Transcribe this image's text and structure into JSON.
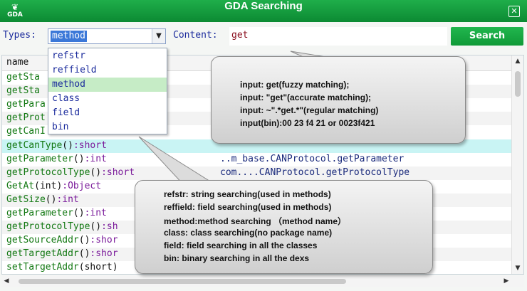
{
  "window": {
    "title": "GDA Searching",
    "logo_text": "GDA",
    "close_glyph": "✕"
  },
  "toolbar": {
    "types_label": "Types:",
    "types_selected": "method",
    "content_label": "Content:",
    "content_value": "get",
    "search_label": "Search"
  },
  "table": {
    "header_name": "name",
    "rows": [
      {
        "method": "getSta",
        "params": "",
        "ret": "",
        "path": ""
      },
      {
        "method": "getSta",
        "params": "",
        "ret": "",
        "path": ""
      },
      {
        "method": "getPara",
        "params": "",
        "ret": "",
        "path": ""
      },
      {
        "method": "getProt",
        "params": "",
        "ret": "",
        "path": ""
      },
      {
        "method": "getCanI",
        "params": "",
        "ret": "",
        "path": ""
      },
      {
        "method": "getCanType",
        "params": "()",
        "ret": ":short",
        "path": ""
      },
      {
        "method": "getParameter",
        "params": "()",
        "ret": ":int",
        "path": "..m_base.CANProtocol.getParameter"
      },
      {
        "method": "getProtocolType",
        "params": "()",
        "ret": ":short",
        "path": "com....CANProtocol.getProtocolType"
      },
      {
        "method": "GetAt",
        "params": "(int)",
        "ret": ":Object",
        "path": ""
      },
      {
        "method": "GetSize",
        "params": "()",
        "ret": ":int",
        "path": ""
      },
      {
        "method": "getParameter",
        "params": "()",
        "ret": ":int",
        "path": ""
      },
      {
        "method": "getProtocolType",
        "params": "()",
        "ret": ":sh",
        "path": ""
      },
      {
        "method": "getSourceAddr",
        "params": "()",
        "ret": ":shor",
        "path": ""
      },
      {
        "method": "getTargetAddr",
        "params": "()",
        "ret": ":shor",
        "path": ""
      },
      {
        "method": "setTargetAddr",
        "params": "(short)",
        "ret": "",
        "path": ""
      }
    ]
  },
  "dropdown": {
    "options": [
      "refstr",
      "reffield",
      "method",
      "class",
      "field",
      "bin"
    ],
    "selected_index": 2
  },
  "callout_top": {
    "lines": [
      "input:       get(fuzzy matching);",
      "input:       \"get\"(accurate matching);",
      "input:       ~\".*get.*\"(regular matching)",
      "input(bin):00 23 f4 21 or 0023f421"
    ]
  },
  "callout_bottom": {
    "lines": [
      "refstr:    string searching(used in methods)",
      "reffield:  field searching(used in methods)",
      "method:method  searching （method  name）",
      "class:     class searching(no package name)",
      "field:      field searching in all the classes",
      "bin:        binary searching in all the dexs"
    ]
  },
  "colors": {
    "title_bar": "#14a03f",
    "search_button": "#18a843",
    "highlight_row": "#c9f4f4",
    "dropdown_selected": "#c6ecc6"
  }
}
